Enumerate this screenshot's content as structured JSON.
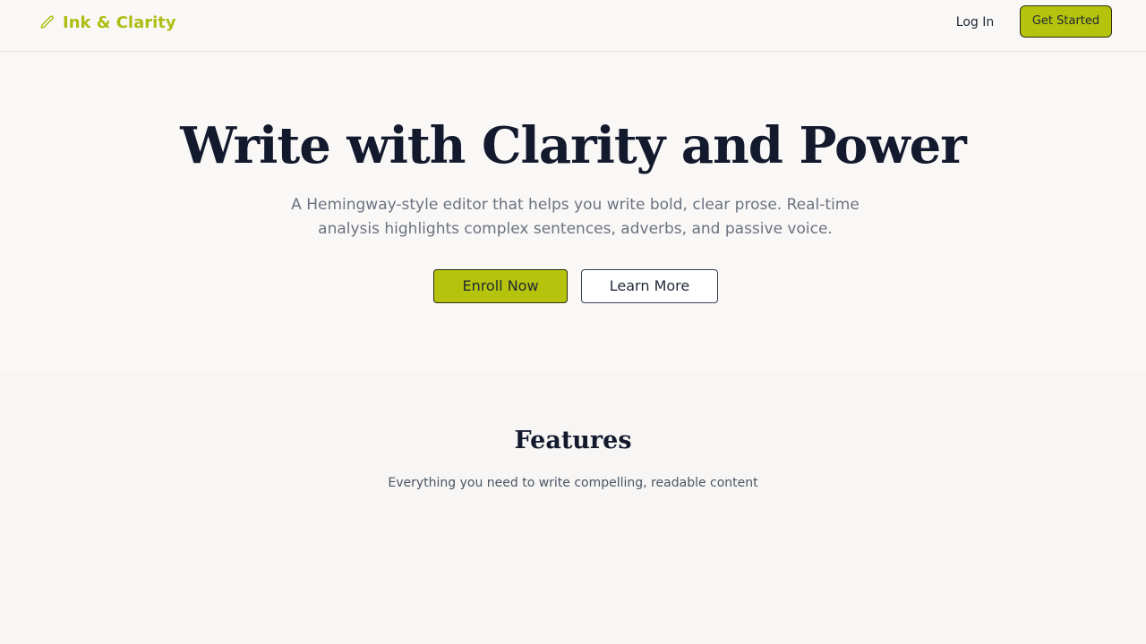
{
  "header": {
    "brand_name": "Ink & Clarity",
    "brand_icon": "pencil-icon",
    "login_label": "Log In",
    "cta_label": "Get Started"
  },
  "hero": {
    "title": "Write with Clarity and Power",
    "subtitle": "A Hemingway-style editor that helps you write bold, clear prose. Real-time analysis highlights complex sentences, adverbs, and passive voice.",
    "primary_button": "Enroll Now",
    "secondary_button": "Learn More"
  },
  "features": {
    "title": "Features",
    "subtitle": "Everything you need to write compelling, readable content"
  },
  "colors": {
    "accent": "#b5c30c",
    "brand_text": "#aebd14",
    "heading": "#141a2e",
    "background": "#f8f7f5"
  }
}
